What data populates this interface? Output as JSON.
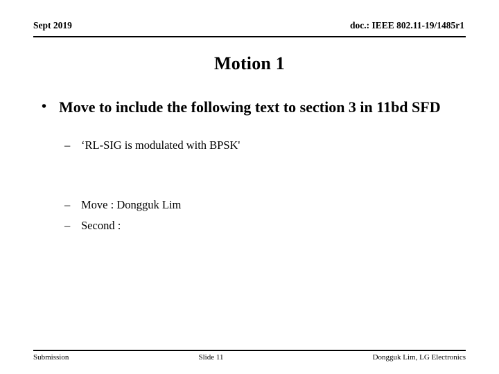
{
  "header": {
    "date": "Sept 2019",
    "doc": "doc.: IEEE 802.11-19/1485r1"
  },
  "title": "Motion 1",
  "body": {
    "bullet_mark": "•",
    "dash_mark": "–",
    "level1": [
      "Move to include the following text to section 3 in 11bd SFD"
    ],
    "level2_group1": [
      "‘RL-SIG is modulated with BPSK'"
    ],
    "level2_group2": [
      "Move : Dongguk Lim",
      "Second :"
    ]
  },
  "footer": {
    "left": "Submission",
    "center": "Slide 11",
    "right": "Dongguk Lim, LG Electronics"
  },
  "colors": {
    "text": "#000000",
    "background": "#ffffff",
    "rule": "#000000"
  }
}
